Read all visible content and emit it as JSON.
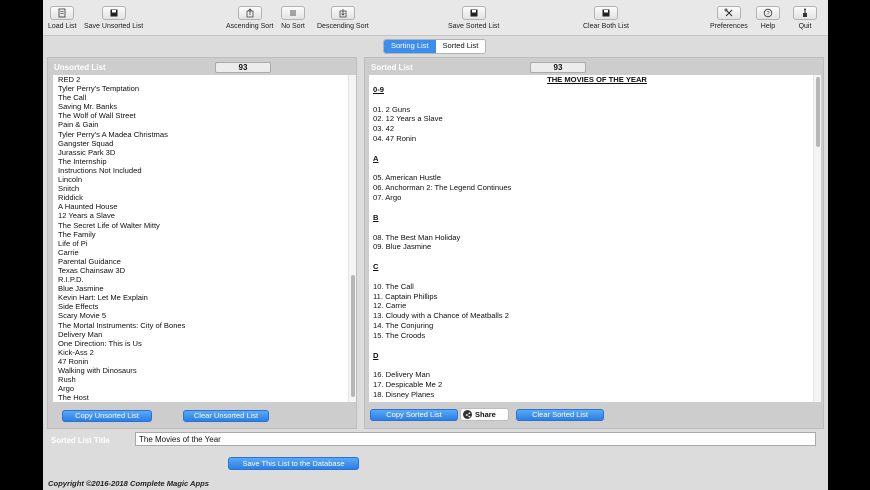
{
  "toolbar": {
    "load_list": "Load List",
    "save_unsorted": "Save Unsorted List",
    "ascending": "Ascending Sort",
    "no_sort": "No Sort",
    "descending": "Descending Sort",
    "save_sorted": "Save Sorted List",
    "clear_both": "Clear Both List",
    "preferences": "Preferences",
    "help": "Help",
    "quit": "Quit"
  },
  "tabs": {
    "sorting": "Sorting List",
    "sorted": "Sorted List",
    "selected": "Sorting List"
  },
  "unsorted": {
    "title": "Unsorted List",
    "count": "93",
    "items": [
      "RED 2",
      "Tyler Perry's Temptation",
      "The Call",
      "Saving Mr. Banks",
      "The Wolf of Wall Street",
      "Pain & Gain",
      "Tyler Perry's A Madea Christmas",
      "Gangster Squad",
      "Jurassic Park 3D",
      "The Internship",
      "Instructions Not Included",
      "Lincoln",
      "Snitch",
      "Riddick",
      "A Haunted House",
      "12 Years a Slave",
      "The Secret Life of Walter Mitty",
      "The Family",
      "Life of Pi",
      "Carrie",
      "Parental Guidance",
      "Texas Chainsaw 3D",
      "R.I.P.D.",
      "Blue Jasmine",
      "Kevin Hart: Let Me Explain",
      "Side Effects",
      "Scary Movie 5",
      "The Mortal Instruments: City of Bones",
      "Delivery Man",
      "One Direction: This is Us",
      "Kick-Ass 2",
      "47 Ronin",
      "Walking with Dinosaurs",
      "Rush",
      "Argo",
      "The Host"
    ]
  },
  "sorted": {
    "title": "Sorted List",
    "count": "93",
    "heading": "THE MOVIES OF THE YEAR",
    "lines": [
      {
        "t": "0-9",
        "k": "letter"
      },
      {
        "t": "",
        "k": "blank"
      },
      {
        "t": "01. 2 Guns",
        "k": "item"
      },
      {
        "t": "02. 12 Years a Slave",
        "k": "item"
      },
      {
        "t": "03. 42",
        "k": "item"
      },
      {
        "t": "04. 47 Ronin",
        "k": "item"
      },
      {
        "t": "",
        "k": "blank"
      },
      {
        "t": "A",
        "k": "letter"
      },
      {
        "t": "",
        "k": "blank"
      },
      {
        "t": "05. American Hustle",
        "k": "item"
      },
      {
        "t": "06. Anchorman 2: The Legend Continues",
        "k": "item"
      },
      {
        "t": "07. Argo",
        "k": "item"
      },
      {
        "t": "",
        "k": "blank"
      },
      {
        "t": "B",
        "k": "letter"
      },
      {
        "t": "",
        "k": "blank"
      },
      {
        "t": "08. The Best Man Holiday",
        "k": "item"
      },
      {
        "t": "09. Blue Jasmine",
        "k": "item"
      },
      {
        "t": "",
        "k": "blank"
      },
      {
        "t": "C",
        "k": "letter"
      },
      {
        "t": "",
        "k": "blank"
      },
      {
        "t": "10. The Call",
        "k": "item"
      },
      {
        "t": "11. Captain Phillips",
        "k": "item"
      },
      {
        "t": "12. Carrie",
        "k": "item"
      },
      {
        "t": "13. Cloudy with a Chance of Meatballs 2",
        "k": "item"
      },
      {
        "t": "14. The Conjuring",
        "k": "item"
      },
      {
        "t": "15. The Croods",
        "k": "item"
      },
      {
        "t": "",
        "k": "blank"
      },
      {
        "t": "D",
        "k": "letter"
      },
      {
        "t": "",
        "k": "blank"
      },
      {
        "t": "16. Delivery Man",
        "k": "item"
      },
      {
        "t": "17. Despicable Me 2",
        "k": "item"
      },
      {
        "t": "18. Disney Planes",
        "k": "item"
      }
    ]
  },
  "buttons": {
    "copy_unsorted": "Copy Unsorted List",
    "clear_unsorted": "Clear Unsorted List",
    "copy_sorted": "Copy Sorted List",
    "share": "Share",
    "clear_sorted": "Clear Sorted List",
    "save_db": "Save This List to the Database"
  },
  "title_field": {
    "label": "Sorted List Title",
    "value": "The Movies of the Year"
  },
  "footer": {
    "copyright": "Copyright ©2016-2018 Complete Magic Apps"
  },
  "colors": {
    "accent": "#3b8eed",
    "window_bg": "#dcdcdc"
  }
}
